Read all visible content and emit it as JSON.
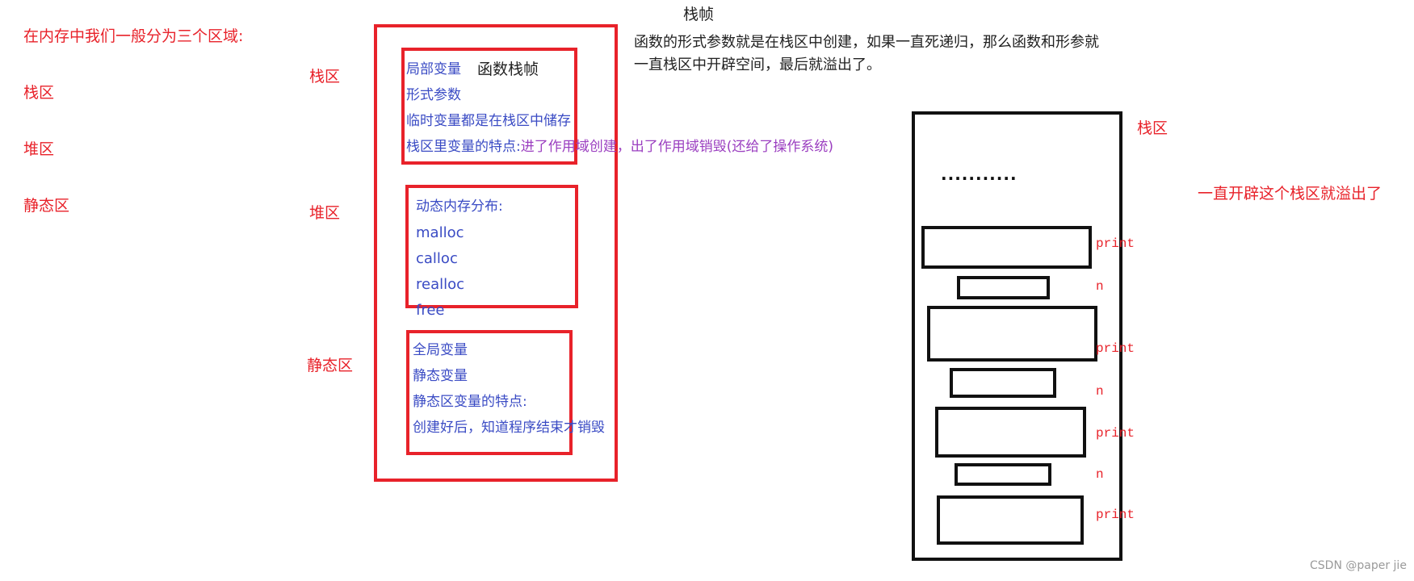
{
  "left": {
    "intro": "在内存中我们一般分为三个区域:",
    "regions": [
      "栈区",
      "堆区",
      "静态区"
    ]
  },
  "labels": {
    "stack": "栈区",
    "heap": "堆区",
    "static": "静态区"
  },
  "stack_box": {
    "line1": "局部变量",
    "frame_label": "函数栈帧",
    "line2": "形式参数",
    "line3": "临时变量都是在栈区中储存",
    "trait_prefix": "栈区里变量的特点:",
    "trait_detail": "进了作用域创建，出了作用域销毁(还给了操作系统)"
  },
  "heap_box": {
    "items": [
      "动态内存分布:",
      "malloc",
      "calloc",
      "realloc",
      "free"
    ]
  },
  "static_box": {
    "items": [
      "全局变量",
      "静态变量",
      "静态区变量的特点:",
      "创建好后，知道程序结束才销毁"
    ]
  },
  "top_note": {
    "title": "栈帧",
    "line1": "函数的形式参数就是在栈区中创建，如果一直死递归，那么函数和形参就",
    "line2": "一直栈区中开辟空间，最后就溢出了。"
  },
  "stack_diagram": {
    "label": "栈区",
    "dots": "...........",
    "overflow_note": "一直开辟这个栈区就溢出了",
    "frames": [
      "print",
      "n",
      "print",
      "n",
      "print",
      "n",
      "print"
    ]
  },
  "watermark": "CSDN @paper jie",
  "colors": {
    "red": "#e8222a",
    "blue": "#3a4bc4",
    "black": "#111111"
  }
}
